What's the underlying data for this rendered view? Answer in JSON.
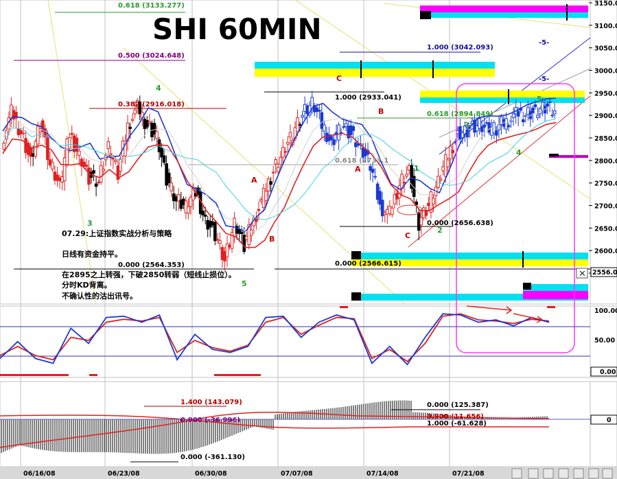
{
  "chart_data": {
    "type": "line",
    "title": "SHI 60MIN",
    "y_axis": {
      "ticks": [
        3150,
        3100,
        3050,
        3000,
        2950,
        2900,
        2850,
        2800,
        2750,
        2700,
        2650,
        2600,
        2550
      ],
      "tick_labels": [
        "3150.00",
        "3100.00",
        "3050.00",
        "3000.00",
        "2950.00",
        "2900.00",
        "2850.00",
        "2800.00",
        "2750.00",
        "2700.00",
        "2650.00",
        "2600.00",
        "2550.00"
      ],
      "current_price_label": "2556.00",
      "range": [
        2530,
        3160
      ]
    },
    "x_axis": {
      "tick_labels": [
        "06/16/08",
        "06/23/08",
        "06/30/08",
        "07/07/08",
        "07/14/08",
        "07/21/08"
      ]
    },
    "fib_labels": [
      {
        "text": "0.618 (3133.277)",
        "color": "#2a9a2a"
      },
      {
        "text": "0.500 (3024.648)",
        "color": "#800080"
      },
      {
        "text": "0.382 (2916.018)",
        "color": "#b00000"
      },
      {
        "text": "0.000 (2564.353)",
        "color": "#000000"
      },
      {
        "text": "1.000 (3042.093)",
        "color": "#1010a0"
      },
      {
        "text": "1.000 (2933.041)",
        "color": "#000000"
      },
      {
        "text": "0.618 (2894.849)",
        "color": "#2a9a2a"
      },
      {
        "text": "0.618 (2733.1",
        "color": "#888888"
      },
      {
        "text": "0.000 (2656.638)",
        "color": "#000000"
      },
      {
        "text": "0.000 (2566.615)",
        "color": "#000000"
      }
    ],
    "wave_labels": [
      {
        "text": "4",
        "color": "#2a9a2a"
      },
      {
        "text": "3",
        "color": "#2a9a2a"
      },
      {
        "text": "A",
        "color": "#c00000"
      },
      {
        "text": "B",
        "color": "#c00000"
      },
      {
        "text": "5",
        "color": "#2a9a2a"
      },
      {
        "text": "C",
        "color": "#c00000"
      },
      {
        "text": "A",
        "color": "#c00000"
      },
      {
        "text": "B",
        "color": "#c00000"
      },
      {
        "text": "1",
        "color": "#2a9a2a"
      },
      {
        "text": "C",
        "color": "#c00000"
      },
      {
        "text": "2",
        "color": "#2a9a2a"
      },
      {
        "text": "3",
        "color": "#2a9a2a"
      },
      {
        "text": "4",
        "color": "#2a9a2a"
      },
      {
        "text": "5",
        "color": "#2a9a2a"
      },
      {
        "text": "-5-",
        "color": "#1010a0"
      },
      {
        "text": "-5-",
        "color": "#1010a0"
      }
    ],
    "annotations": [
      "07.29:上证指数实战分析与策略",
      "日线有资金持平。",
      "在2895之上转强，下破2850转弱（短线止损位）。",
      "分时KD背离。",
      "不确认性的沽出讯号。"
    ],
    "price_series": [
      2840,
      2905,
      2865,
      2800,
      2885,
      2790,
      2740,
      2860,
      2815,
      2765,
      2755,
      2830,
      2770,
      2880,
      2915,
      2880,
      2855,
      2760,
      2710,
      2695,
      2730,
      2670,
      2640,
      2580,
      2660,
      2610,
      2670,
      2720,
      2780,
      2820,
      2860,
      2900,
      2925,
      2880,
      2840,
      2880,
      2860,
      2825,
      2790,
      2700,
      2680,
      2750,
      2780,
      2660,
      2700,
      2750,
      2810,
      2860,
      2870,
      2880,
      2872,
      2868,
      2890,
      2900,
      2905,
      2910,
      2920,
      2910
    ],
    "kd_panel": {
      "tick_labels": [
        "100.00",
        "50.00",
        "0.00"
      ],
      "k_values": [
        20,
        48,
        20,
        12,
        70,
        45,
        88,
        90,
        80,
        92,
        18,
        60,
        35,
        30,
        40,
        88,
        90,
        55,
        80,
        92,
        84,
        12,
        40,
        10,
        55,
        94,
        92,
        80,
        84,
        74,
        88,
        80
      ],
      "d_values": [
        25,
        40,
        25,
        18,
        55,
        50,
        80,
        85,
        82,
        88,
        30,
        50,
        38,
        32,
        42,
        80,
        88,
        60,
        75,
        88,
        86,
        20,
        35,
        15,
        45,
        90,
        94,
        84,
        82,
        78,
        85,
        82
      ]
    },
    "macd_panel": {
      "tick_label": "0",
      "labels": [
        {
          "text": "1.400 (143.079)",
          "color": "#b00000"
        },
        {
          "text": "0.000 (125.387)",
          "color": "#000000"
        },
        {
          "text": "0.900 (-36.996)",
          "color": "#800080"
        },
        {
          "text": "0.900 (11.656)",
          "color": "#b00000"
        },
        {
          "text": "1.000 (-61.628)",
          "color": "#000000"
        },
        {
          "text": "0.000 (-361.130)",
          "color": "#000000"
        }
      ]
    }
  }
}
